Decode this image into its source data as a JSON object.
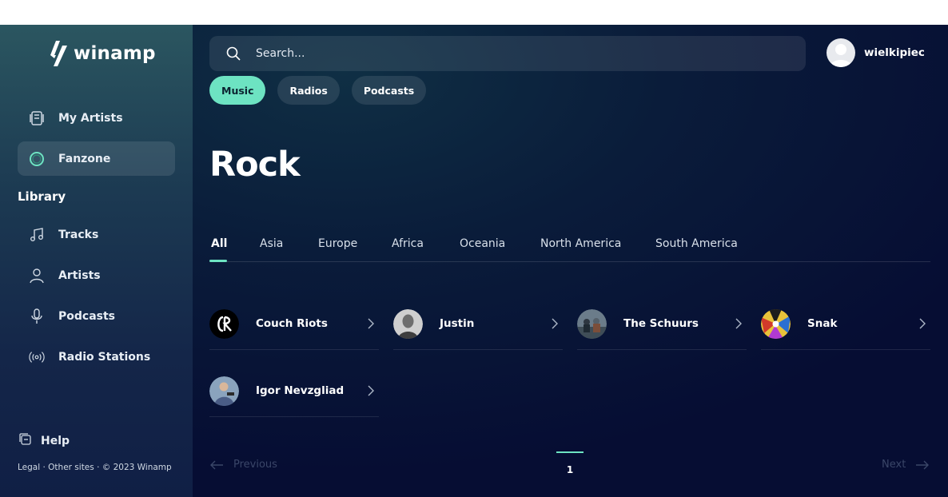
{
  "brand": {
    "name": "winamp"
  },
  "sidebar": {
    "top_items": [
      {
        "label": "My Artists",
        "icon": "artists-stack-icon",
        "active": false
      },
      {
        "label": "Fanzone",
        "icon": "fanzone-ring-icon",
        "active": true
      }
    ],
    "library_title": "Library",
    "library_items": [
      {
        "label": "Tracks",
        "icon": "music-note-icon"
      },
      {
        "label": "Artists",
        "icon": "person-icon"
      },
      {
        "label": "Podcasts",
        "icon": "microphone-icon"
      },
      {
        "label": "Radio Stations",
        "icon": "broadcast-icon"
      }
    ],
    "help_label": "Help",
    "footer": "Legal · Other sites · © 2023 Winamp"
  },
  "header": {
    "search_placeholder": "Search...",
    "username": "wielkipiec"
  },
  "pills": [
    {
      "label": "Music",
      "active": true
    },
    {
      "label": "Radios",
      "active": false
    },
    {
      "label": "Podcasts",
      "active": false
    }
  ],
  "page_title": "Rock",
  "regions": [
    {
      "label": "All",
      "active": true
    },
    {
      "label": "Asia"
    },
    {
      "label": "Europe"
    },
    {
      "label": "Africa"
    },
    {
      "label": "Oceania"
    },
    {
      "label": "North America"
    },
    {
      "label": "South America"
    }
  ],
  "artists": [
    {
      "name": "Couch Riots"
    },
    {
      "name": "Justin"
    },
    {
      "name": "The Schuurs"
    },
    {
      "name": "Snak"
    },
    {
      "name": "Igor Nevzgliad"
    }
  ],
  "pagination": {
    "previous": "Previous",
    "next": "Next",
    "current_page": "1"
  },
  "colors": {
    "accent": "#6de3c2",
    "main_bg": "#060d33",
    "sidebar_top": "#2b5660"
  }
}
